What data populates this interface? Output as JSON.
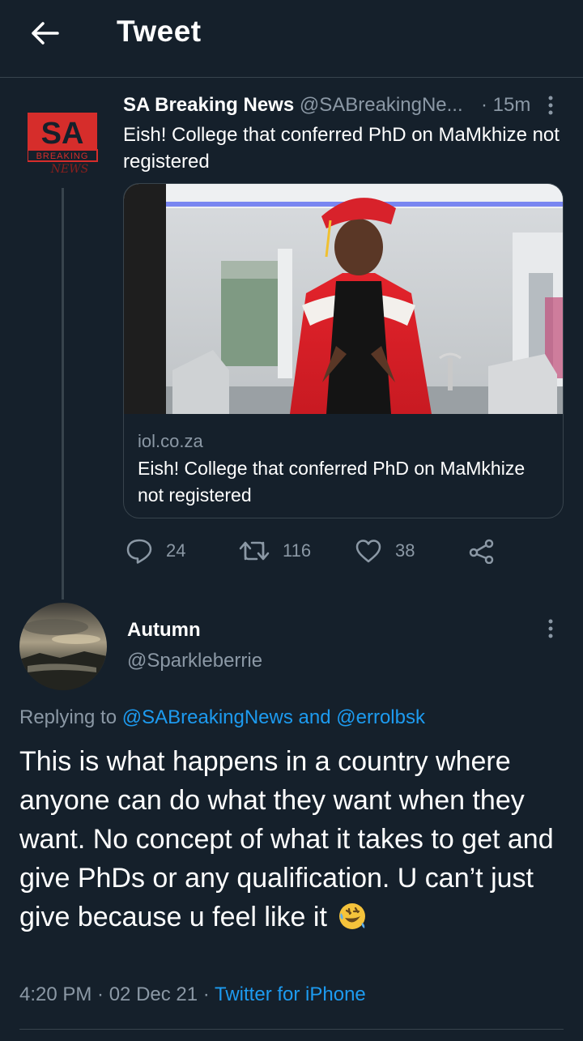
{
  "header": {
    "back_icon": "arrow-left-icon",
    "title": "Tweet"
  },
  "parent_tweet": {
    "name": "SA Breaking News",
    "handle": "@SABreakingNe...",
    "time": "· 15m",
    "text": "Eish! College that conferred PhD on MaMkhize not registered",
    "avatar": {
      "line1": "SA",
      "line2": "BREAKING",
      "line3": "NEWS"
    },
    "card": {
      "domain": "iol.co.za",
      "title": "Eish! College that conferred PhD on MaMkhize not registered"
    },
    "actions": {
      "replies": "24",
      "retweets": "116",
      "likes": "38"
    }
  },
  "main_tweet": {
    "name": "Autumn",
    "handle": "@Sparkleberrie",
    "replying_prefix": "Replying to ",
    "replying_to": "@SABreakingNews and @errolbsk",
    "text": "This is what happens in a country where anyone can do what they want when they want. No concept of what it takes to get and give PhDs or any qualification. U can’t just give because u feel like it",
    "emoji": "rolling-on-floor-laughing",
    "timestamp": "4:20 PM · 02 Dec 21 · ",
    "source": "Twitter for iPhone"
  },
  "colors": {
    "background": "#15202b",
    "accent": "#1d9bf0",
    "secondary_text": "#8b98a5",
    "divider": "#38444d",
    "brand_red": "#d62d2b"
  }
}
